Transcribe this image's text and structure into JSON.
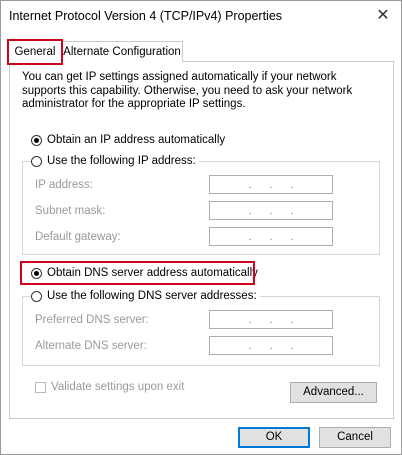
{
  "window": {
    "title": "Internet Protocol Version 4 (TCP/IPv4) Properties",
    "close_glyph": "✕"
  },
  "tabs": [
    {
      "label": "General",
      "selected": true
    },
    {
      "label": "Alternate Configuration",
      "selected": false
    }
  ],
  "intro_text": "You can get IP settings assigned automatically if your network supports this capability. Otherwise, you need to ask your network administrator for the appropriate IP settings.",
  "ip_section": {
    "auto_label": "Obtain an IP address automatically",
    "manual_label": "Use the following IP address:",
    "fields": [
      {
        "label": "IP address:",
        "value": ". . ."
      },
      {
        "label": "Subnet mask:",
        "value": ". . ."
      },
      {
        "label": "Default gateway:",
        "value": ". . ."
      }
    ]
  },
  "dns_section": {
    "auto_label": "Obtain DNS server address automatically",
    "manual_label": "Use the following DNS server addresses:",
    "fields": [
      {
        "label": "Preferred DNS server:",
        "value": ". . ."
      },
      {
        "label": "Alternate DNS server:",
        "value": ". . ."
      }
    ]
  },
  "validate_label": "Validate settings upon exit",
  "buttons": {
    "advanced": "Advanced...",
    "ok": "OK",
    "cancel": "Cancel"
  },
  "colors": {
    "highlight": "#d0021b",
    "focus_blue": "#0078d7"
  }
}
